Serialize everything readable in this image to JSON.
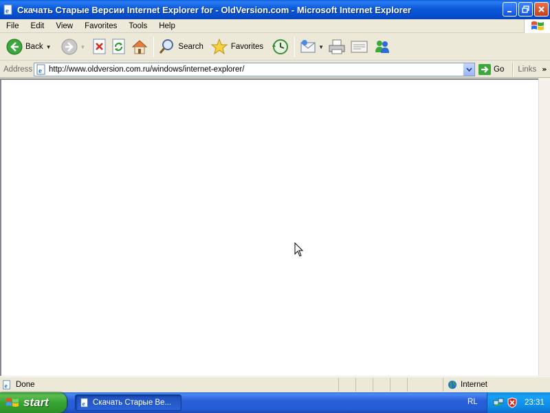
{
  "window": {
    "title": "Скачать Старые Версии Internet Explorer for - OldVersion.com - Microsoft Internet Explorer"
  },
  "menu": {
    "items": [
      "File",
      "Edit",
      "View",
      "Favorites",
      "Tools",
      "Help"
    ]
  },
  "toolbar": {
    "back_label": "Back",
    "search_label": "Search",
    "favorites_label": "Favorites"
  },
  "addressbar": {
    "label": "Address",
    "url": "http://www.oldversion.com.ru/windows/internet-explorer/",
    "go_label": "Go",
    "links_label": "Links"
  },
  "statusbar": {
    "status_text": "Done",
    "zone_text": "Internet"
  },
  "taskbar": {
    "start_label": "start",
    "task_label": "Скачать Старые Ве...",
    "language": "RL",
    "clock": "23:31"
  },
  "colors": {
    "titlebar": "#0a5fe0",
    "taskbar": "#245cd7",
    "start_button": "#37a533",
    "tray": "#0f8be6"
  },
  "icons": [
    "ie-page-icon",
    "minimize-icon",
    "maximize-icon",
    "close-icon",
    "windows-logo-icon",
    "back-arrow-icon",
    "forward-arrow-icon",
    "stop-icon",
    "refresh-icon",
    "home-icon",
    "search-icon",
    "favorites-star-icon",
    "history-icon",
    "mail-icon",
    "print-icon",
    "edit-icon",
    "messenger-icon",
    "go-arrow-icon",
    "globe-icon",
    "mouse-cursor-icon",
    "network-icon",
    "security-shield-icon"
  ]
}
